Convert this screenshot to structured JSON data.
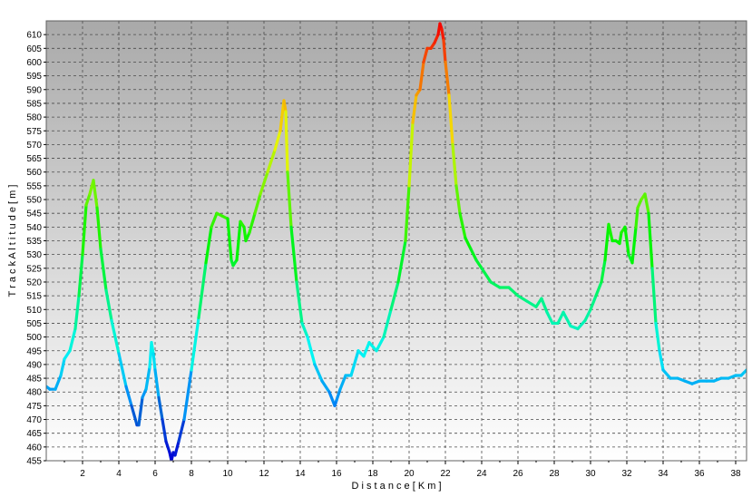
{
  "chart_data": {
    "type": "line",
    "xlabel": "D i s t a n c e   [ K m ]",
    "ylabel": "T r a c k   A l t i t u d e   [ m ]",
    "xlim": [
      0,
      38.6
    ],
    "ylim": [
      455,
      615
    ],
    "x_ticks": [
      "2",
      "4",
      "6",
      "8",
      "10",
      "12",
      "14",
      "16",
      "18",
      "20",
      "22",
      "24",
      "26",
      "28",
      "30",
      "32",
      "34",
      "36",
      "38"
    ],
    "y_ticks": [
      "455",
      "460",
      "465",
      "470",
      "475",
      "480",
      "485",
      "490",
      "495",
      "500",
      "505",
      "510",
      "515",
      "520",
      "525",
      "530",
      "535",
      "540",
      "545",
      "550",
      "555",
      "560",
      "565",
      "570",
      "575",
      "580",
      "585",
      "590",
      "595",
      "600",
      "605",
      "610"
    ],
    "grid": true,
    "background_gradient": [
      "#a9a9a9",
      "#ffffff"
    ],
    "color_scale": {
      "low": "#0000ff",
      "mid_low": "#00ffff",
      "mid": "#00ff00",
      "mid_high": "#ffff00",
      "high": "#ff0000"
    },
    "series": [
      {
        "x": [
          0.0,
          0.2,
          0.5,
          0.8,
          1.0,
          1.3,
          1.6,
          1.8,
          2.0,
          2.2,
          2.4,
          2.6,
          2.8,
          3.0,
          3.3,
          3.6,
          4.0,
          4.4,
          4.7,
          5.0,
          5.1,
          5.3,
          5.5,
          5.7,
          5.8,
          5.9,
          6.0,
          6.2,
          6.4,
          6.6,
          6.8,
          6.9,
          7.0,
          7.1,
          7.3,
          7.6,
          8.0,
          8.4,
          8.8,
          9.1,
          9.4,
          9.7,
          10.0,
          10.2,
          10.3,
          10.5,
          10.7,
          10.9,
          11.0,
          11.2,
          11.5,
          11.8,
          12.2,
          12.6,
          12.9,
          13.1,
          13.2,
          13.3,
          13.5,
          13.8,
          14.1,
          14.4,
          14.8,
          15.2,
          15.6,
          15.9,
          16.0,
          16.2,
          16.5,
          16.8,
          17.2,
          17.5,
          17.8,
          18.2,
          18.6,
          19.0,
          19.4,
          19.8,
          20.0,
          20.2,
          20.4,
          20.6,
          20.8,
          21.0,
          21.2,
          21.4,
          21.6,
          21.7,
          21.8,
          21.9,
          22.0,
          22.2,
          22.4,
          22.6,
          22.8,
          23.1,
          23.4,
          23.7,
          24.0,
          24.5,
          25.0,
          25.5,
          26.0,
          26.5,
          27.0,
          27.3,
          27.6,
          27.9,
          28.2,
          28.5,
          28.9,
          29.3,
          29.7,
          30.0,
          30.3,
          30.6,
          30.8,
          31.0,
          31.2,
          31.4,
          31.6,
          31.7,
          31.9,
          32.1,
          32.3,
          32.5,
          32.6,
          32.8,
          33.0,
          33.2,
          33.4,
          33.6,
          33.8,
          34.0,
          34.4,
          34.8,
          35.2,
          35.6,
          36.0,
          36.4,
          36.8,
          37.2,
          37.6,
          38.0,
          38.3,
          38.6
        ],
        "y": [
          482,
          481,
          481,
          486,
          492,
          495,
          503,
          515,
          530,
          548,
          552,
          557,
          547,
          532,
          517,
          506,
          494,
          482,
          475,
          468,
          468,
          478,
          481,
          489,
          498,
          494,
          488,
          478,
          470,
          462,
          458,
          455,
          458,
          457,
          462,
          470,
          488,
          507,
          527,
          540,
          545,
          544,
          543,
          528,
          526,
          528,
          542,
          540,
          535,
          538,
          545,
          552,
          560,
          568,
          575,
          586,
          582,
          560,
          540,
          520,
          505,
          500,
          490,
          484,
          480,
          475,
          477,
          481,
          486,
          486,
          495,
          493,
          498,
          495,
          500,
          510,
          520,
          535,
          555,
          578,
          588,
          590,
          600,
          605,
          605,
          607,
          610,
          614,
          612,
          608,
          600,
          588,
          570,
          555,
          545,
          536,
          532,
          528,
          525,
          520,
          518,
          518,
          515,
          513,
          511,
          514,
          509,
          505,
          505,
          509,
          504,
          503,
          506,
          510,
          515,
          520,
          528,
          541,
          535,
          535,
          534,
          538,
          540,
          530,
          527,
          540,
          547,
          550,
          552,
          545,
          525,
          505,
          495,
          488,
          485,
          485,
          484,
          483,
          484,
          484,
          484,
          485,
          485,
          486,
          486,
          488
        ]
      }
    ]
  }
}
